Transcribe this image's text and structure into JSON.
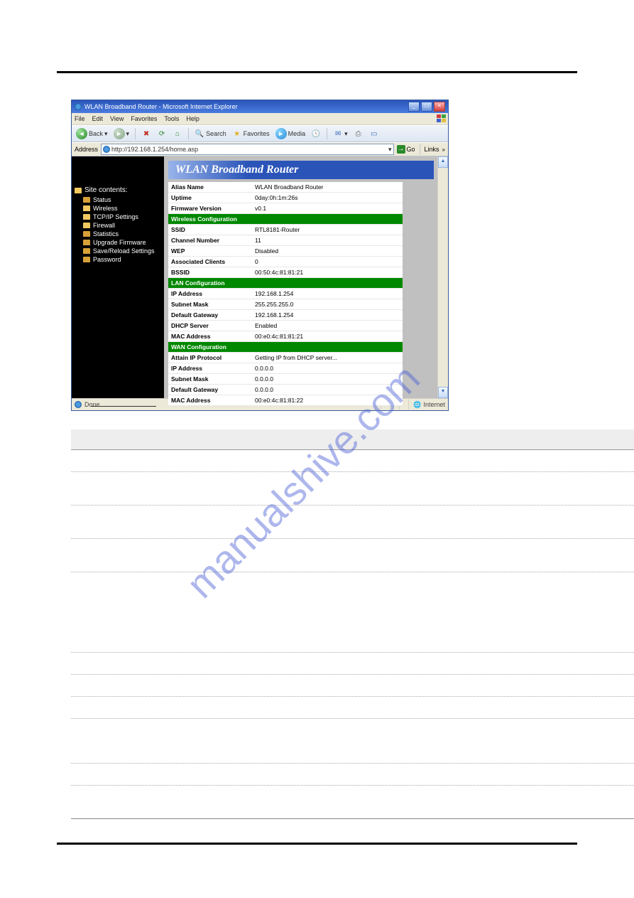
{
  "window": {
    "title": "WLAN Broadband Router - Microsoft Internet Explorer"
  },
  "menubar": [
    "File",
    "Edit",
    "View",
    "Favorites",
    "Tools",
    "Help"
  ],
  "toolbar": {
    "back": "Back",
    "search": "Search",
    "favorites": "Favorites",
    "media": "Media"
  },
  "addressbar": {
    "label": "Address",
    "url": "http://192.168.1.254/home.asp",
    "go": "Go",
    "links": "Links"
  },
  "sidebar": {
    "title": "Site contents:",
    "items": [
      {
        "label": "Status",
        "open": false
      },
      {
        "label": "Wireless",
        "open": true
      },
      {
        "label": "TCP/IP Settings",
        "open": true
      },
      {
        "label": "Firewall",
        "open": true
      },
      {
        "label": "Statistics",
        "open": false
      },
      {
        "label": "Upgrade Firmware",
        "open": false
      },
      {
        "label": "Save/Reload Settings",
        "open": false
      },
      {
        "label": "Password",
        "open": false
      }
    ]
  },
  "banner": "WLAN Broadband Router",
  "table": {
    "rows": [
      {
        "k": "Alias Name",
        "v": "WLAN Broadband Router"
      },
      {
        "k": "Uptime",
        "v": "0day:0h:1m:26s"
      },
      {
        "k": "Firmware Version",
        "v": "v0.1"
      },
      {
        "section": "Wireless Configuration"
      },
      {
        "k": "SSID",
        "v": "RTL8181-Router"
      },
      {
        "k": "Channel Number",
        "v": "11"
      },
      {
        "k": "WEP",
        "v": "Disabled"
      },
      {
        "k": "Associated Clients",
        "v": "0"
      },
      {
        "k": "BSSID",
        "v": "00:50:4c:81:81:21"
      },
      {
        "section": "LAN Configuration"
      },
      {
        "k": "IP Address",
        "v": "192.168.1.254"
      },
      {
        "k": "Subnet Mask",
        "v": "255.255.255.0"
      },
      {
        "k": "Default Gateway",
        "v": "192.168.1.254"
      },
      {
        "k": "DHCP Server",
        "v": "Enabled"
      },
      {
        "k": "MAC Address",
        "v": "00:e0:4c:81:81:21"
      },
      {
        "section": "WAN Configuration"
      },
      {
        "k": "Attain IP Protocol",
        "v": "Getting IP from DHCP server..."
      },
      {
        "k": "IP Address",
        "v": "0.0.0.0"
      },
      {
        "k": "Subnet Mask",
        "v": "0.0.0.0"
      },
      {
        "k": "Default Gateway",
        "v": "0.0.0.0"
      },
      {
        "k": "MAC Address",
        "v": "00:e0:4c:81:81:22"
      }
    ]
  },
  "statusbar": {
    "done": "Done",
    "zone": "Internet"
  },
  "watermark": "manualshive.com"
}
